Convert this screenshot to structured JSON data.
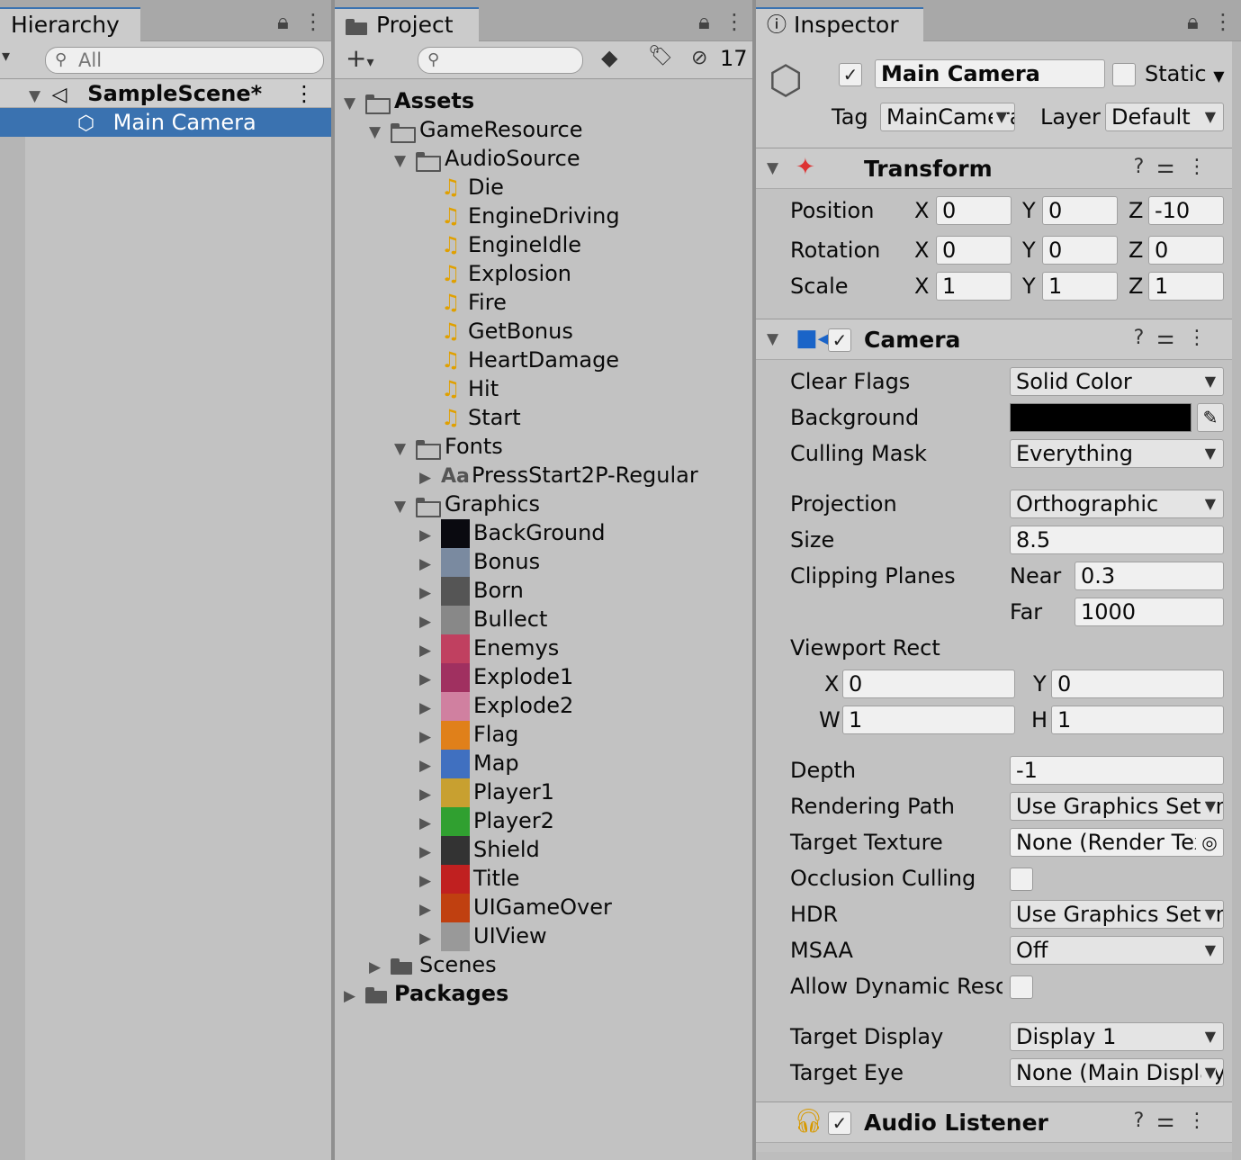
{
  "hierarchy": {
    "tab_label": "Hierarchy",
    "search_placeholder": "All",
    "scene_name": "SampleScene*",
    "items": [
      {
        "label": "Main Camera"
      }
    ]
  },
  "project": {
    "tab_label": "Project",
    "hidden_count": "17",
    "tree": [
      {
        "label": "Assets"
      },
      {
        "label": "GameResource"
      },
      {
        "label": "AudioSource"
      },
      {
        "label": "Die"
      },
      {
        "label": "EngineDriving"
      },
      {
        "label": "EngineIdle"
      },
      {
        "label": "Explosion"
      },
      {
        "label": "Fire"
      },
      {
        "label": "GetBonus"
      },
      {
        "label": "HeartDamage"
      },
      {
        "label": "Hit"
      },
      {
        "label": "Start"
      },
      {
        "label": "Fonts"
      },
      {
        "label": "PressStart2P-Regular"
      },
      {
        "label": "Graphics"
      },
      {
        "label": "BackGround"
      },
      {
        "label": "Bonus"
      },
      {
        "label": "Born"
      },
      {
        "label": "Bullect"
      },
      {
        "label": "Enemys"
      },
      {
        "label": "Explode1"
      },
      {
        "label": "Explode2"
      },
      {
        "label": "Flag"
      },
      {
        "label": "Map"
      },
      {
        "label": "Player1"
      },
      {
        "label": "Player2"
      },
      {
        "label": "Shield"
      },
      {
        "label": "Title"
      },
      {
        "label": "UIGameOver"
      },
      {
        "label": "UIView"
      },
      {
        "label": "Scenes"
      },
      {
        "label": "Packages"
      }
    ]
  },
  "inspector": {
    "tab_label": "Inspector",
    "object_name": "Main Camera",
    "static_label": "Static",
    "tag_label": "Tag",
    "tag_value": "MainCamera",
    "layer_label": "Layer",
    "layer_value": "Default",
    "transform": {
      "title": "Transform",
      "position_label": "Position",
      "rotation_label": "Rotation",
      "scale_label": "Scale",
      "position": {
        "x": "0",
        "y": "0",
        "z": "-10"
      },
      "rotation": {
        "x": "0",
        "y": "0",
        "z": "0"
      },
      "scale": {
        "x": "1",
        "y": "1",
        "z": "1"
      }
    },
    "camera": {
      "title": "Camera",
      "clear_flags_label": "Clear Flags",
      "clear_flags": "Solid Color",
      "background_label": "Background",
      "background_color": "#000000",
      "culling_mask_label": "Culling Mask",
      "culling_mask": "Everything",
      "projection_label": "Projection",
      "projection": "Orthographic",
      "size_label": "Size",
      "size": "8.5",
      "clipping_label": "Clipping Planes",
      "near_label": "Near",
      "near": "0.3",
      "far_label": "Far",
      "far": "1000",
      "viewport_label": "Viewport Rect",
      "vx": "0",
      "vy": "0",
      "vw": "1",
      "vh": "1",
      "depth_label": "Depth",
      "depth": "-1",
      "rendering_path_label": "Rendering Path",
      "rendering_path": "Use Graphics Settings",
      "target_texture_label": "Target Texture",
      "target_texture": "None (Render Texture)",
      "occlusion_label": "Occlusion Culling",
      "hdr_label": "HDR",
      "hdr": "Use Graphics Settings",
      "msaa_label": "MSAA",
      "msaa": "Off",
      "dyn_res_label": "Allow Dynamic Resolution",
      "target_display_label": "Target Display",
      "target_display": "Display 1",
      "target_eye_label": "Target Eye",
      "target_eye": "None (Main Display)"
    },
    "audio_listener": {
      "title": "Audio Listener"
    }
  }
}
